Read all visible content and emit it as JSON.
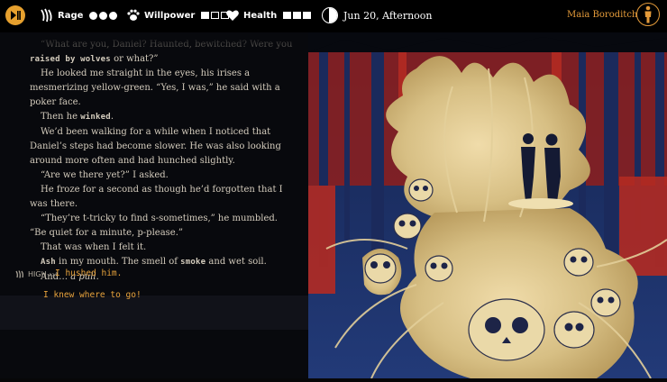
{
  "hud": {
    "stats": [
      {
        "name": "Rage",
        "icon": "claw-marks-icon",
        "kind": "dots",
        "value": 3,
        "max": 3
      },
      {
        "name": "Willpower",
        "icon": "paw-icon",
        "kind": "boxes",
        "value": 1,
        "max": 3
      },
      {
        "name": "Health",
        "icon": "heart-icon",
        "kind": "boxes",
        "value": 3,
        "max": 3
      }
    ],
    "date": "Jun 20, Afternoon",
    "character_name": "Maia Boroditch"
  },
  "story": {
    "paragraphs": [
      [
        {
          "t": "“What are you, Daniel? Haunted, bewitched? Were you "
        }
      ],
      [
        {
          "t": "raised by wolves",
          "mono": true
        },
        {
          "t": " or what?”"
        }
      ],
      [
        {
          "t": "He looked me straight in the eyes, his irises a mesmerizing yellow-green. “Yes, I was,” he said with a poker face."
        }
      ],
      [
        {
          "t": "Then he "
        },
        {
          "t": "winked",
          "mono": true
        },
        {
          "t": "."
        }
      ],
      [
        {
          "t": "We’d been walking for a while when I noticed that Daniel’s steps had become slower. He was also looking around more often and had hunched slightly."
        }
      ],
      [
        {
          "t": "“Are we there yet?” I asked."
        }
      ],
      [
        {
          "t": "He froze for a second as though he’d forgotten that I was there."
        }
      ],
      [
        {
          "t": "“They’re t-tricky to find s-sometimes,” he mumbled. “Be quiet for a minute, p-please.”"
        }
      ],
      [
        {
          "t": "That was when I felt it."
        }
      ],
      [
        {
          "t": "Ash",
          "mono": true
        },
        {
          "t": " in my mouth. The smell of "
        },
        {
          "t": "smoke",
          "mono": true
        },
        {
          "t": " and wet soil."
        }
      ],
      [
        {
          "t": "And… "
        },
        {
          "t": "a pull",
          "italic": true
        },
        {
          "t": "."
        }
      ]
    ]
  },
  "choices": {
    "tag": "HIGH",
    "selected": "I hushed him.",
    "options": [
      "I knew where to go!"
    ]
  },
  "colors": {
    "accent": "#e7a23c",
    "art_blue": "#1c2f63",
    "art_red": "#a3241d",
    "art_bone": "#d9c28a"
  }
}
